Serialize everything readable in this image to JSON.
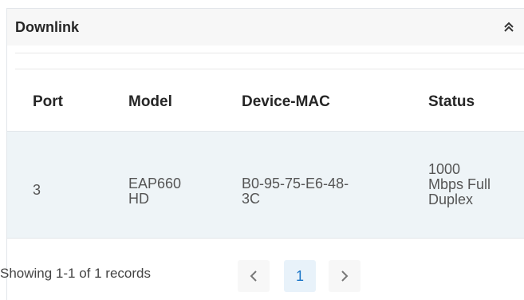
{
  "panel": {
    "title": "Downlink",
    "collapse_icon": "double-chevron-up-icon"
  },
  "table": {
    "headers": [
      "Port",
      "Model",
      "Device-MAC",
      "Status"
    ],
    "rows": [
      {
        "port": "3",
        "model_line1": "EAP660",
        "model_line2": "HD",
        "mac_line1": "B0-95-75-E6-48-",
        "mac_line2": "3C",
        "status_line1": "1000",
        "status_line2": "Mbps Full",
        "status_line3": "Duplex"
      }
    ]
  },
  "pagination": {
    "summary": "Showing 1-1 of 1 records",
    "prev_icon": "chevron-left-icon",
    "current_page": "1",
    "next_icon": "chevron-right-icon"
  },
  "colors": {
    "accent": "#1a75c7",
    "row_highlight": "#eef4f7"
  }
}
